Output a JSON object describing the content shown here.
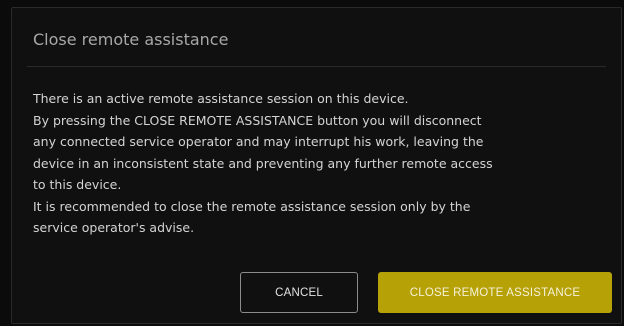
{
  "dialog": {
    "title": "Close remote assistance",
    "body_lines": [
      "There is an active remote assistance session on this device.",
      "By pressing the CLOSE REMOTE ASSISTANCE button you will disconnect",
      "any connected service operator and may interrupt his work, leaving the",
      "device in an inconsistent state and preventing any further remote access",
      "to this device.",
      "It is recommended to close the remote assistance session only by the",
      "service operator's advise."
    ],
    "buttons": {
      "cancel_label": "CANCEL",
      "close_label": "CLOSE REMOTE ASSISTANCE"
    }
  },
  "colors": {
    "background": "#0b0b0b",
    "dialog_background": "#101010",
    "accent": "#b6a106",
    "title_text": "#a8a8a8",
    "body_text": "#d4d4d4"
  }
}
